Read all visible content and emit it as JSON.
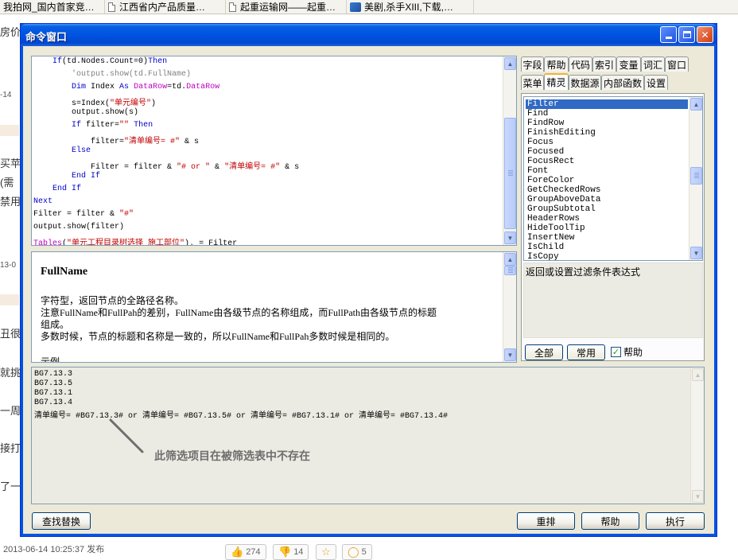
{
  "browser": {
    "bookmarks": [
      {
        "label": "我拍网_国内首家竞…",
        "icon": "none"
      },
      {
        "label": "江西省内产品质量…",
        "icon": "page-icon"
      },
      {
        "label": "起重运输网——起重…",
        "icon": "page-icon"
      },
      {
        "label": "美剧,杀手XIII,下载,…",
        "icon": "image-icon"
      }
    ]
  },
  "background_page": {
    "fragments": [
      "房价",
      "-14",
      "买苹",
      "(需",
      "禁用",
      "13-0",
      "丑很",
      "就挑",
      "一周",
      "接打",
      "了一"
    ],
    "footer_time": "2013-06-14 10:25:37 发布",
    "votes": {
      "up": "274",
      "down": "14",
      "comments": "5"
    }
  },
  "window": {
    "title": "命令窗口",
    "colors": {
      "titlebar": "#0054e3",
      "keyword": "#0000c8",
      "string": "#c00000",
      "selection": "#316ac5"
    }
  },
  "code": {
    "lines": [
      [
        {
          "t": "    "
        },
        {
          "c": "kw",
          "t": "If"
        },
        {
          "t": "(td.Nodes.Count=0)"
        },
        {
          "c": "kw",
          "t": "Then"
        }
      ],
      [
        {
          "t": "        "
        },
        {
          "c": "cm",
          "t": "'output.show(td.FullName)"
        }
      ],
      [
        {
          "t": "        "
        },
        {
          "c": "kw",
          "t": "Dim"
        },
        {
          "t": " Index "
        },
        {
          "c": "kw",
          "t": "As"
        },
        {
          "t": " "
        },
        {
          "c": "ty",
          "t": "DataRow"
        },
        {
          "t": "=td."
        },
        {
          "c": "ty",
          "t": "DataRow"
        }
      ],
      [
        {
          "t": "        s=Index("
        },
        {
          "c": "str",
          "t": "\"单元编号\""
        },
        {
          "t": ")"
        }
      ],
      [
        {
          "t": "        output.show(s)"
        }
      ],
      [
        {
          "t": "        "
        },
        {
          "c": "kw",
          "t": "If"
        },
        {
          "t": " filter="
        },
        {
          "c": "str",
          "t": "\"\""
        },
        {
          "t": " "
        },
        {
          "c": "kw",
          "t": "Then"
        }
      ],
      [
        {
          "t": "            filter="
        },
        {
          "c": "str",
          "t": "\"清单编号= #\""
        },
        {
          "t": " & s"
        }
      ],
      [
        {
          "t": "        "
        },
        {
          "c": "kw",
          "t": "Else"
        }
      ],
      [
        {
          "t": "            Filter = filter & "
        },
        {
          "c": "str",
          "t": "\"# or \""
        },
        {
          "t": " & "
        },
        {
          "c": "str",
          "t": "\"清单编号= #\""
        },
        {
          "t": " & s"
        }
      ],
      [
        {
          "t": "        "
        },
        {
          "c": "kw",
          "t": "End If"
        }
      ],
      [
        {
          "t": "    "
        },
        {
          "c": "kw",
          "t": "End If"
        }
      ],
      [
        {
          "c": "kw",
          "t": "Next"
        }
      ],
      [
        {
          "t": "Filter = filter & "
        },
        {
          "c": "str",
          "t": "\"#\""
        }
      ],
      [
        {
          "t": "output.show(filter)"
        }
      ],
      [
        {
          "c": "ty",
          "t": "Tables"
        },
        {
          "t": "("
        },
        {
          "c": "str",
          "t": "\"单元工程目录树选择_施工部位\""
        },
        {
          "t": ")"
        },
        {
          "c": "str",
          "t": "."
        },
        {
          "t": " = Filter"
        }
      ]
    ]
  },
  "help": {
    "title": "FullName",
    "lines": [
      "字符型，返回节点的全路径名称。",
      "注意FullName和FullPah的差别，FullName由各级节点的名称组成，而FullPath由各级节点的标题",
      "组成。",
      "多数时候，节点的标题和名称是一致的，所以FullName和FullPah多数时候是相同的。",
      "",
      "示例"
    ]
  },
  "right_panel": {
    "tabs_row1": [
      "字段",
      "帮助",
      "代码",
      "索引",
      "变量",
      "词汇",
      "窗口"
    ],
    "tabs_row2": [
      "菜单",
      "精灵",
      "数据源",
      "内部函数",
      "设置"
    ],
    "active_tab": "精灵",
    "members": [
      "Filter",
      "Find",
      "FindRow",
      "FinishEditing",
      "Focus",
      "Focused",
      "FocusRect",
      "Font",
      "ForeColor",
      "GetCheckedRows",
      "GroupAboveData",
      "GroupSubtotal",
      "HeaderRows",
      "HideToolTip",
      "InsertNew",
      "IsChild",
      "IsCopy"
    ],
    "selected_member": "Filter",
    "description": "返回或设置过滤条件表达式",
    "all_button": "全部",
    "common_button": "常用",
    "help_checkbox": "帮助",
    "help_checked": true
  },
  "output": {
    "lines": [
      "BG7.13.3",
      "BG7.13.5",
      "BG7.13.1",
      "BG7.13.4",
      "清单编号= #BG7.13.3# or 清单编号= #BG7.13.5# or 清单编号= #BG7.13.1# or 清单编号= #BG7.13.4#"
    ],
    "annotation": "此筛选项目在被筛选表中不存在"
  },
  "buttons": {
    "find_replace": "查找替换",
    "rearrange": "重排",
    "help": "帮助",
    "execute": "执行"
  }
}
